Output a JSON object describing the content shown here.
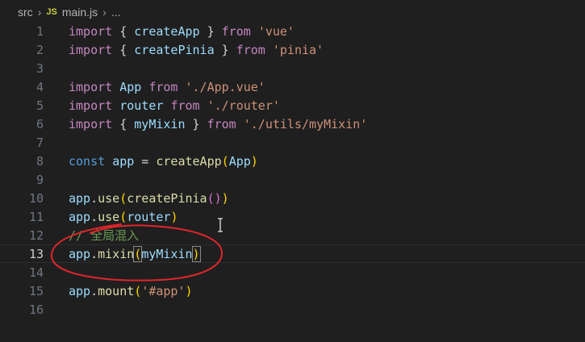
{
  "breadcrumb": {
    "folder": "src",
    "file_badge": "JS",
    "file": "main.js",
    "more": "..."
  },
  "editor": {
    "line_numbers": [
      "1",
      "2",
      "3",
      "4",
      "5",
      "6",
      "7",
      "8",
      "9",
      "10",
      "11",
      "12",
      "13",
      "14",
      "15",
      "16"
    ],
    "current_line": "13",
    "tokens": {
      "import": "import",
      "from": "from",
      "const": "const",
      "lbrace": "{ ",
      "rbrace": " }",
      "createApp": "createApp",
      "createPinia": "createPinia",
      "App": "App",
      "router": "router",
      "myMixin": "myMixin",
      "app": "app",
      "use": "use",
      "mixin": "mixin",
      "mount": "mount",
      "str_vue": "'vue'",
      "str_pinia": "'pinia'",
      "str_app_vue": "'./App.vue'",
      "str_router": "'./router'",
      "str_mymixin": "'./utils/myMixin'",
      "str_app_id": "'#app'",
      "comment": "// 全局混入"
    }
  },
  "annotation": {
    "color": "#e0262b"
  }
}
